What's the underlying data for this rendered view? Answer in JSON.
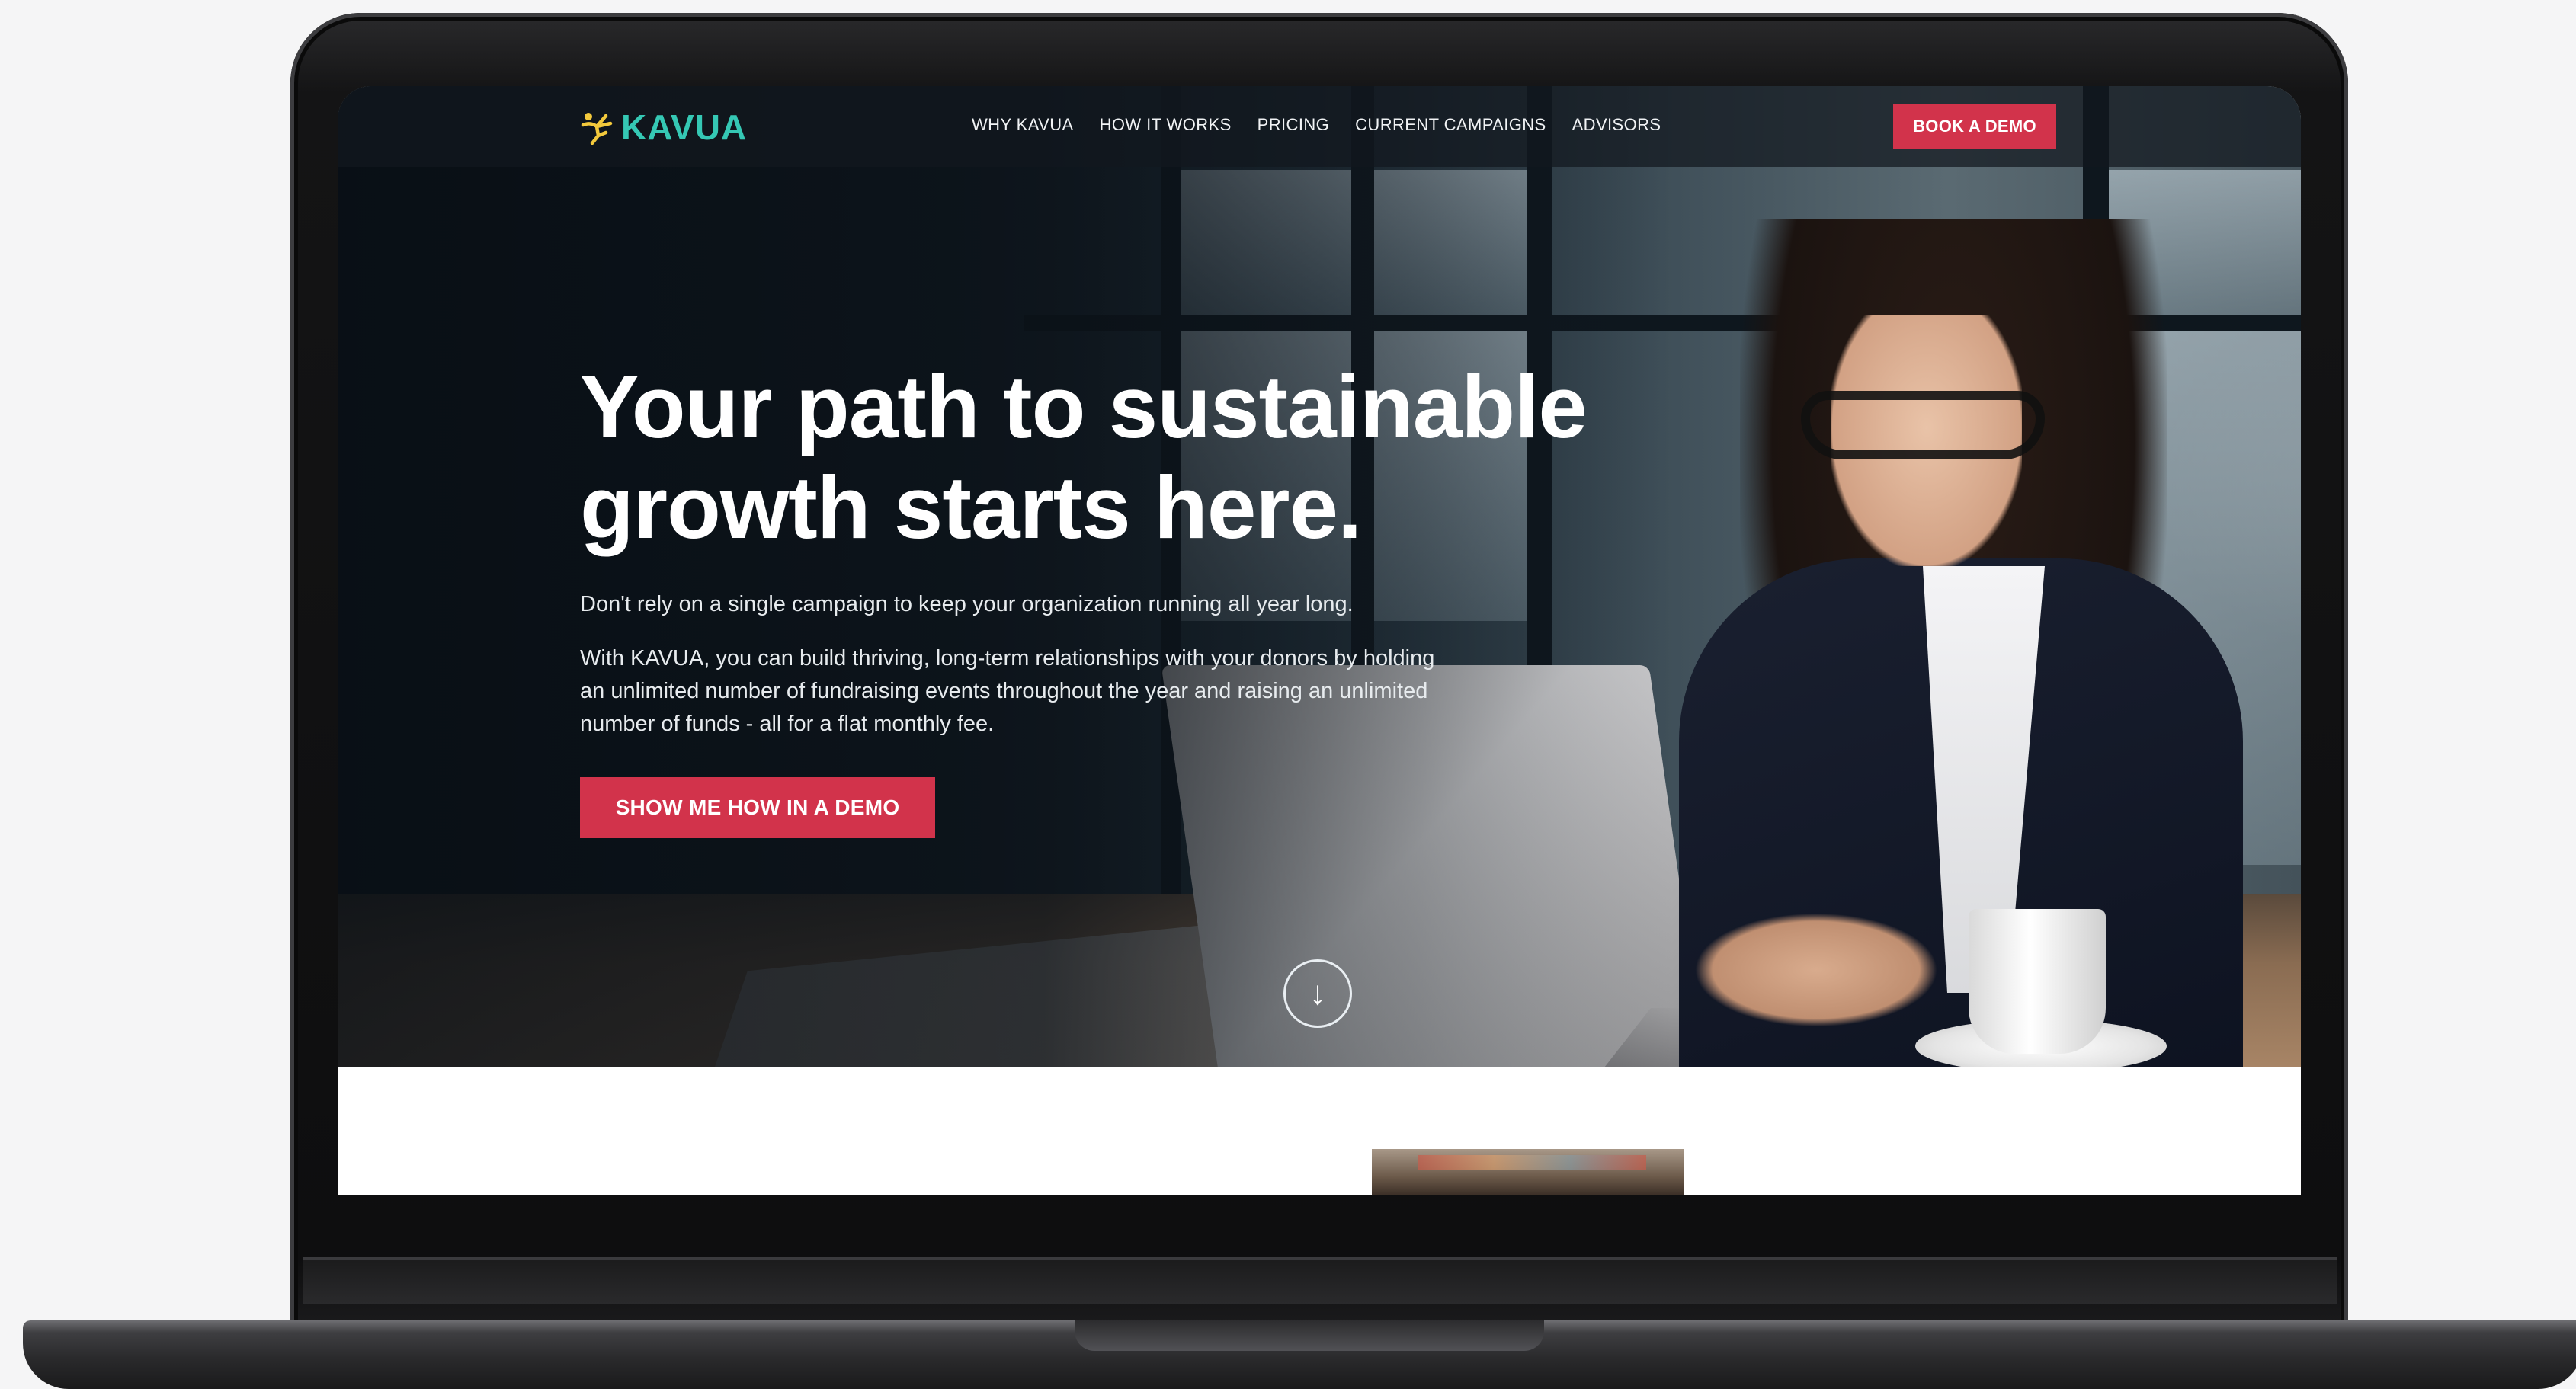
{
  "nav": {
    "logo_text": "KAVUA",
    "links": [
      "WHY KAVUA",
      "HOW IT WORKS",
      "PRICING",
      "CURRENT CAMPAIGNS",
      "ADVISORS"
    ],
    "cta_label": "BOOK A DEMO"
  },
  "hero": {
    "headline": "Your path to sustainable growth starts here.",
    "lead": "Don't rely on a single campaign to keep your organization running all year long.",
    "body": "With KAVUA, you can build thriving, long-term relationships with your donors by holding an unlimited number of fundraising events throughout the year and raising an unlimited number of funds - all for a flat monthly fee.",
    "cta_label": "SHOW ME HOW IN A DEMO",
    "scroll_icon": "arrow-down-icon"
  },
  "colors": {
    "brand_teal": "#35c8b4",
    "logo_figure": "#f3c93c",
    "accent_red": "#d2334b"
  }
}
